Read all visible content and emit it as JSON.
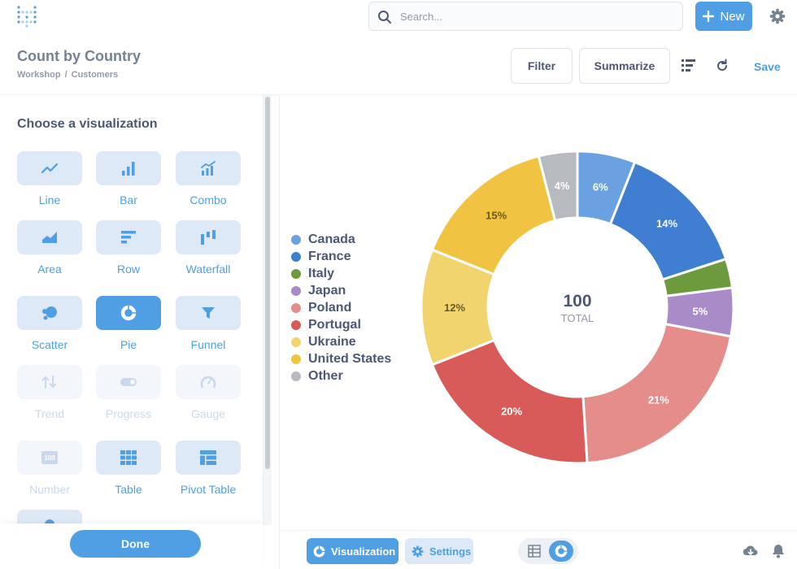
{
  "search": {
    "placeholder": "Search..."
  },
  "topbar": {
    "new_label": "New"
  },
  "header": {
    "title": "Count by Country",
    "breadcrumb": [
      "Workshop",
      "Customers"
    ],
    "breadcrumb_sep": "/",
    "filter_label": "Filter",
    "summarize_label": "Summarize",
    "save_label": "Save"
  },
  "sidebar": {
    "heading": "Choose a visualization",
    "viz_types": [
      {
        "label": "Line",
        "icon": "line-chart-icon",
        "state": "normal"
      },
      {
        "label": "Bar",
        "icon": "bar-chart-icon",
        "state": "normal"
      },
      {
        "label": "Combo",
        "icon": "combo-chart-icon",
        "state": "normal"
      },
      {
        "label": "Area",
        "icon": "area-chart-icon",
        "state": "normal"
      },
      {
        "label": "Row",
        "icon": "row-chart-icon",
        "state": "normal"
      },
      {
        "label": "Waterfall",
        "icon": "waterfall-chart-icon",
        "state": "normal"
      },
      {
        "label": "Scatter",
        "icon": "scatter-chart-icon",
        "state": "normal"
      },
      {
        "label": "Pie",
        "icon": "pie-chart-icon",
        "state": "active"
      },
      {
        "label": "Funnel",
        "icon": "funnel-chart-icon",
        "state": "normal"
      },
      {
        "label": "Trend",
        "icon": "trend-icon",
        "state": "disabled"
      },
      {
        "label": "Progress",
        "icon": "progress-icon",
        "state": "disabled"
      },
      {
        "label": "Gauge",
        "icon": "gauge-icon",
        "state": "disabled"
      },
      {
        "label": "Number",
        "icon": "number-icon",
        "state": "disabled"
      },
      {
        "label": "Table",
        "icon": "table-icon",
        "state": "normal"
      },
      {
        "label": "Pivot Table",
        "icon": "pivot-table-icon",
        "state": "normal"
      }
    ],
    "number_icon_text": "100",
    "done_label": "Done"
  },
  "bottom": {
    "visualization_label": "Visualization",
    "settings_label": "Settings"
  },
  "colors": {
    "brand": "#509ee3",
    "brand_light": "#dde9f7",
    "text": "#4c5773"
  },
  "chart_data": {
    "type": "pie",
    "donut": true,
    "center_value": "100",
    "center_label": "TOTAL",
    "slices": [
      {
        "name": "Canada",
        "value": 6,
        "label": "6%",
        "color": "#6aa1e0"
      },
      {
        "name": "France",
        "value": 14,
        "label": "14%",
        "color": "#3f7ed1"
      },
      {
        "name": "Italy",
        "value": 3,
        "label": "",
        "color": "#6d9a3c"
      },
      {
        "name": "Japan",
        "value": 5,
        "label": "5%",
        "color": "#a98bc8"
      },
      {
        "name": "Poland",
        "value": 21,
        "label": "21%",
        "color": "#e58d8a"
      },
      {
        "name": "Portugal",
        "value": 20,
        "label": "20%",
        "color": "#d85b5a"
      },
      {
        "name": "Ukraine",
        "value": 12,
        "label": "12%",
        "color": "#f2d46e"
      },
      {
        "name": "United States",
        "value": 15,
        "label": "15%",
        "color": "#f0c442"
      },
      {
        "name": "Other",
        "value": 4,
        "label": "4%",
        "color": "#b7babf"
      }
    ]
  }
}
